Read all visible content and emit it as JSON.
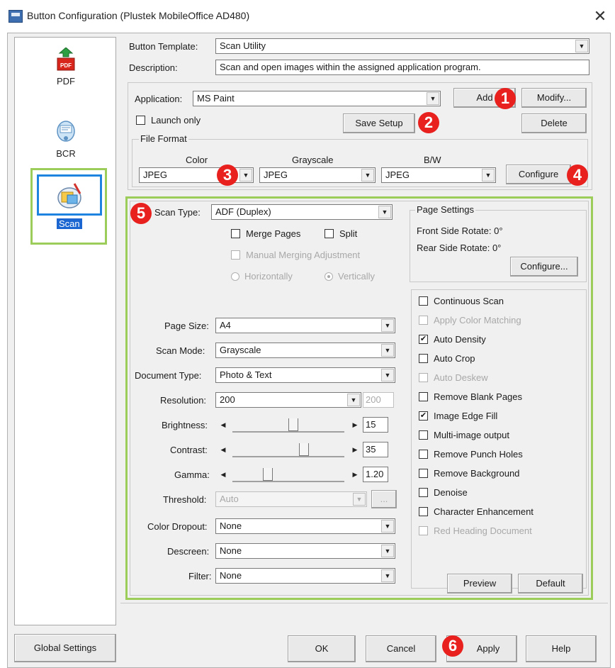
{
  "window": {
    "title": "Button Configuration (Plustek MobileOffice AD480)",
    "close": "✕"
  },
  "sidebar": {
    "items": [
      {
        "label": "PDF",
        "icon": "pdf-icon"
      },
      {
        "label": "BCR",
        "icon": "bcr-icon"
      },
      {
        "label": "Scan",
        "icon": "scan-icon",
        "selected": true
      }
    ]
  },
  "header": {
    "template_label": "Button Template:",
    "template_value": "Scan Utility",
    "description_label": "Description:",
    "description_value": "Scan and open images within the assigned application program."
  },
  "application": {
    "label": "Application:",
    "value": "MS Paint",
    "add": "Add",
    "modify": "Modify...",
    "launch_only": "Launch only",
    "save_setup": "Save Setup",
    "delete": "Delete"
  },
  "file_format": {
    "title": "File Format",
    "color_label": "Color",
    "color_value": "JPEG",
    "grayscale_label": "Grayscale",
    "grayscale_value": "JPEG",
    "bw_label": "B/W",
    "bw_value": "JPEG",
    "configure": "Configure"
  },
  "scan": {
    "scan_type_label": "Scan Type:",
    "scan_type_value": "ADF (Duplex)",
    "merge_pages": "Merge Pages",
    "split": "Split",
    "manual_merging": "Manual Merging Adjustment",
    "horizontally": "Horizontally",
    "vertically": "Vertically",
    "page_settings": {
      "title": "Page Settings",
      "front_rotate": "Front Side Rotate: 0°",
      "rear_rotate": "Rear Side Rotate: 0°",
      "configure": "Configure..."
    },
    "page_size_label": "Page Size:",
    "page_size_value": "A4",
    "scan_mode_label": "Scan Mode:",
    "scan_mode_value": "Grayscale",
    "document_type_label": "Document Type:",
    "document_type_value": "Photo & Text",
    "resolution_label": "Resolution:",
    "resolution_value": "200",
    "resolution_secondary": "200",
    "brightness_label": "Brightness:",
    "brightness_value": "15",
    "brightness_level": 0.55,
    "contrast_label": "Contrast:",
    "contrast_value": "35",
    "contrast_level": 0.65,
    "gamma_label": "Gamma:",
    "gamma_value": "1.20",
    "gamma_level": 0.3,
    "threshold_label": "Threshold:",
    "threshold_value": "Auto",
    "threshold_extra": "...",
    "color_dropout_label": "Color Dropout:",
    "color_dropout_value": "None",
    "descreen_label": "Descreen:",
    "descreen_value": "None",
    "filter_label": "Filter:",
    "filter_value": "None",
    "preview": "Preview",
    "default": "Default"
  },
  "options": [
    {
      "label": "Continuous Scan",
      "checked": false,
      "enabled": true
    },
    {
      "label": "Apply Color Matching",
      "checked": false,
      "enabled": false
    },
    {
      "label": "Auto Density",
      "checked": true,
      "enabled": true
    },
    {
      "label": "Auto Crop",
      "checked": false,
      "enabled": true
    },
    {
      "label": "Auto Deskew",
      "checked": false,
      "enabled": false
    },
    {
      "label": "Remove Blank Pages",
      "checked": false,
      "enabled": true
    },
    {
      "label": "Image Edge Fill",
      "checked": true,
      "enabled": true
    },
    {
      "label": "Multi-image output",
      "checked": false,
      "enabled": true
    },
    {
      "label": "Remove Punch Holes",
      "checked": false,
      "enabled": true
    },
    {
      "label": "Remove Background",
      "checked": false,
      "enabled": true
    },
    {
      "label": "Denoise",
      "checked": false,
      "enabled": true
    },
    {
      "label": "Character Enhancement",
      "checked": false,
      "enabled": true
    },
    {
      "label": "Red Heading Document",
      "checked": false,
      "enabled": false
    }
  ],
  "footer": {
    "global_settings": "Global Settings",
    "ok": "OK",
    "cancel": "Cancel",
    "apply": "Apply",
    "help": "Help"
  },
  "callouts": [
    "1",
    "2",
    "3",
    "4",
    "5",
    "6"
  ],
  "colors": {
    "callout": "#e8201e",
    "highlight_frame": "#9ccc5a",
    "selection": "#1b66d1"
  }
}
